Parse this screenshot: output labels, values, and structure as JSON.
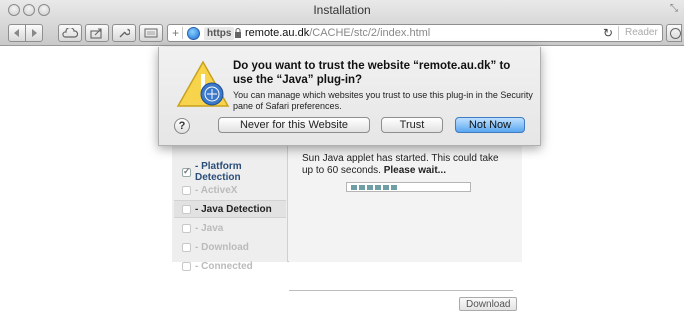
{
  "window": {
    "title": "Installation",
    "resize_glyph": "⤡"
  },
  "toolbar": {
    "back_icon": "back-arrow",
    "forward_icon": "forward-arrow"
  },
  "address_bar": {
    "plus": "+",
    "https_label": "https",
    "host": "remote.au.dk",
    "path": "/CACHE/stc/2/index.html",
    "reload_icon": "reload",
    "reader_label": "Reader"
  },
  "dialog": {
    "title": "Do you want to trust the website “remote.au.dk” to use the “Java” plug-in?",
    "body": "You can manage which websites you trust to use this plug-in in the Security pane of Safari preferences.",
    "help_label": "?",
    "never_label": "Never for this Website",
    "trust_label": "Trust",
    "not_now_label": "Not Now"
  },
  "installer": {
    "steps": [
      {
        "label": "- Platform Detection",
        "state": "done"
      },
      {
        "label": "- ActiveX",
        "state": "pending"
      },
      {
        "label": "- Java Detection",
        "state": "current"
      },
      {
        "label": "- Java",
        "state": "pending"
      },
      {
        "label": "- Download",
        "state": "pending"
      },
      {
        "label": "- Connected",
        "state": "pending"
      }
    ],
    "status_text_1": "Sun Java applet has started. This could take up to 60 seconds.",
    "status_text_bold": "Please wait...",
    "progress_segments": 6,
    "download_label": "Download"
  },
  "colors": {
    "accent_button": "#5aa7f0",
    "step_done": "#2b4d7a",
    "progress_fill": "#6f9fa6"
  }
}
